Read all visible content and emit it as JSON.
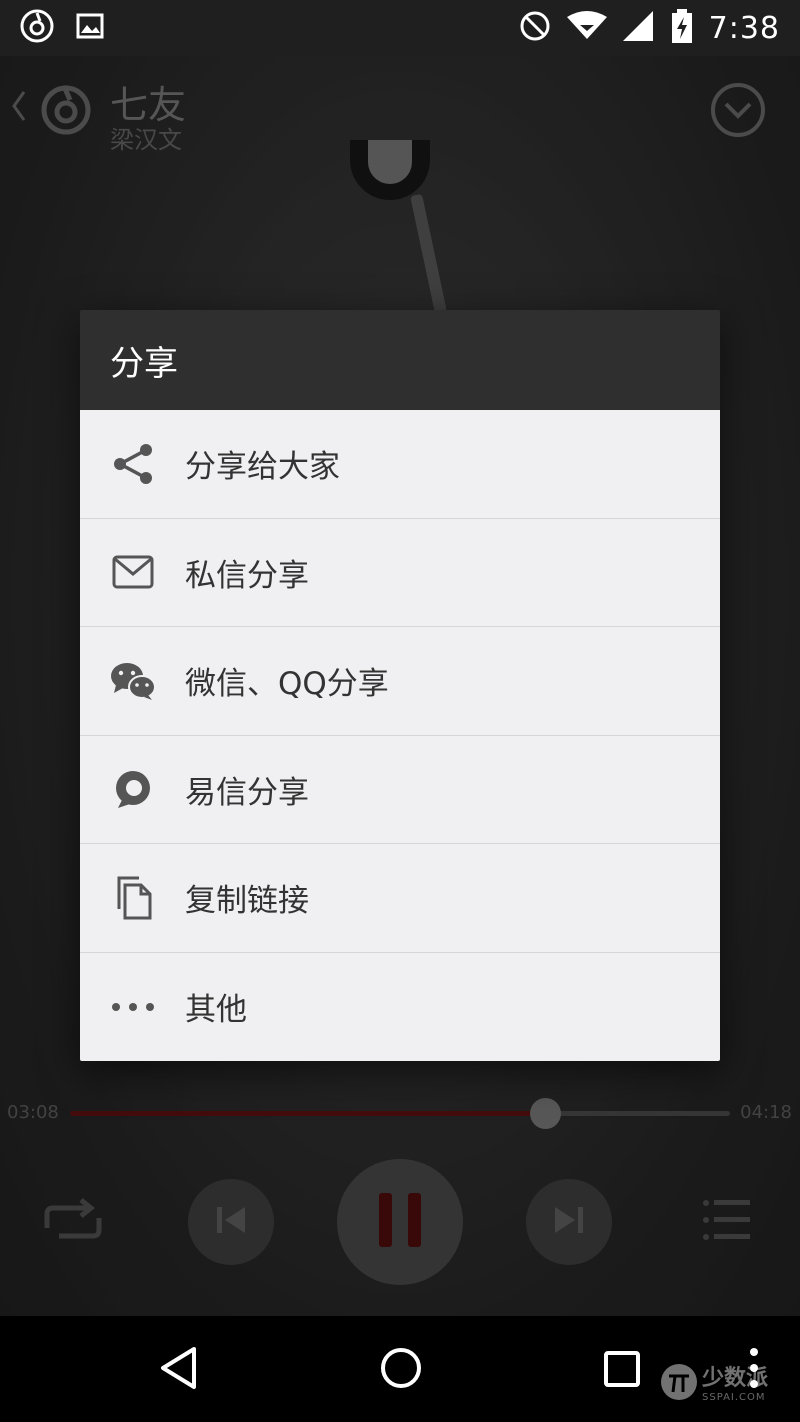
{
  "status_bar": {
    "time": "7:38",
    "icons": [
      "netease-music-icon",
      "image-icon",
      "do-not-disturb-icon",
      "wifi-icon",
      "signal-icon",
      "battery-charging-icon"
    ]
  },
  "player": {
    "song_title": "七友",
    "artist": "梁汉文",
    "current_time": "03:08",
    "total_time": "04:18",
    "progress": 0.72,
    "accent_color": "#6e1414",
    "state": "playing"
  },
  "dialog": {
    "title": "分享",
    "items": [
      {
        "label": "分享给大家",
        "icon": "share-icon"
      },
      {
        "label": "私信分享",
        "icon": "mail-icon"
      },
      {
        "label": "微信、QQ分享",
        "icon": "wechat-icon"
      },
      {
        "label": "易信分享",
        "icon": "yixin-icon"
      },
      {
        "label": "复制链接",
        "icon": "copy-icon"
      },
      {
        "label": "其他",
        "icon": "more-icon"
      }
    ]
  },
  "nav_bar": {
    "buttons": [
      "back",
      "home",
      "recents",
      "menu"
    ]
  },
  "watermark": {
    "text": "少数派",
    "sub": "SSPAI.COM"
  }
}
